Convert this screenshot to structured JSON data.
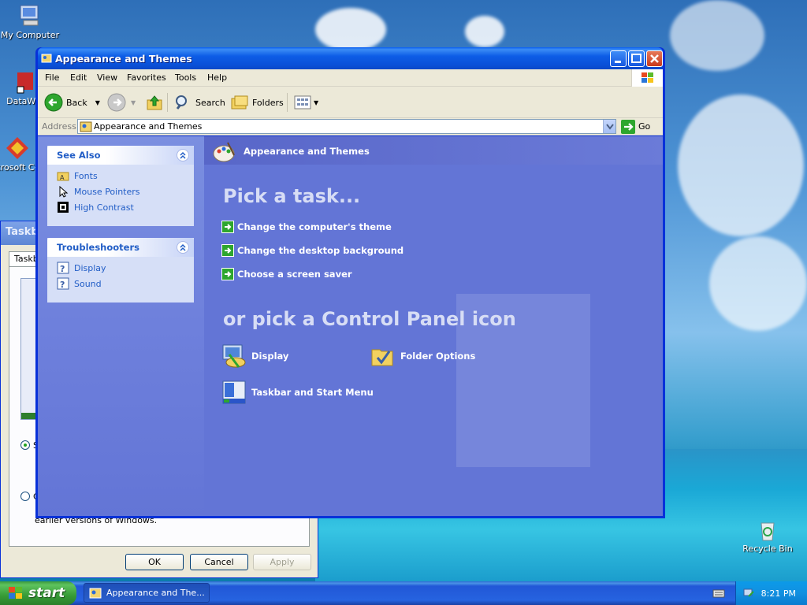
{
  "desktop": {
    "icons": [
      {
        "label": "My Computer"
      },
      {
        "label": "DataWar"
      },
      {
        "label": "Microsoft C++"
      },
      {
        "label": "Recycle Bin"
      }
    ]
  },
  "background_dialog": {
    "title": "Taskb",
    "tab": "Taskb",
    "radio1_label": "S",
    "radio2_label": "C",
    "small_text": "earlier versions of Windows.",
    "ok": "OK",
    "cancel": "Cancel",
    "apply": "Apply"
  },
  "window": {
    "title": "Appearance and Themes",
    "menu": [
      "File",
      "Edit",
      "View",
      "Favorites",
      "Tools",
      "Help"
    ],
    "toolbar": {
      "back": "Back",
      "search": "Search",
      "folders": "Folders"
    },
    "address": {
      "label": "Address",
      "value": "Appearance and Themes",
      "go": "Go"
    },
    "see_also": {
      "title": "See Also",
      "items": [
        "Fonts",
        "Mouse Pointers",
        "High Contrast"
      ]
    },
    "troubleshooters": {
      "title": "Troubleshooters",
      "items": [
        "Display",
        "Sound"
      ]
    },
    "header": "Appearance and Themes",
    "pick_task": "Pick a task...",
    "tasks": [
      "Change the computer's theme",
      "Change the desktop background",
      "Choose a screen saver"
    ],
    "or_pick": "or pick a Control Panel icon",
    "icons": [
      "Display",
      "Folder Options",
      "Taskbar and Start Menu"
    ]
  },
  "taskbar": {
    "start": "start",
    "task": "Appearance and The...",
    "clock": "8:21 PM"
  }
}
